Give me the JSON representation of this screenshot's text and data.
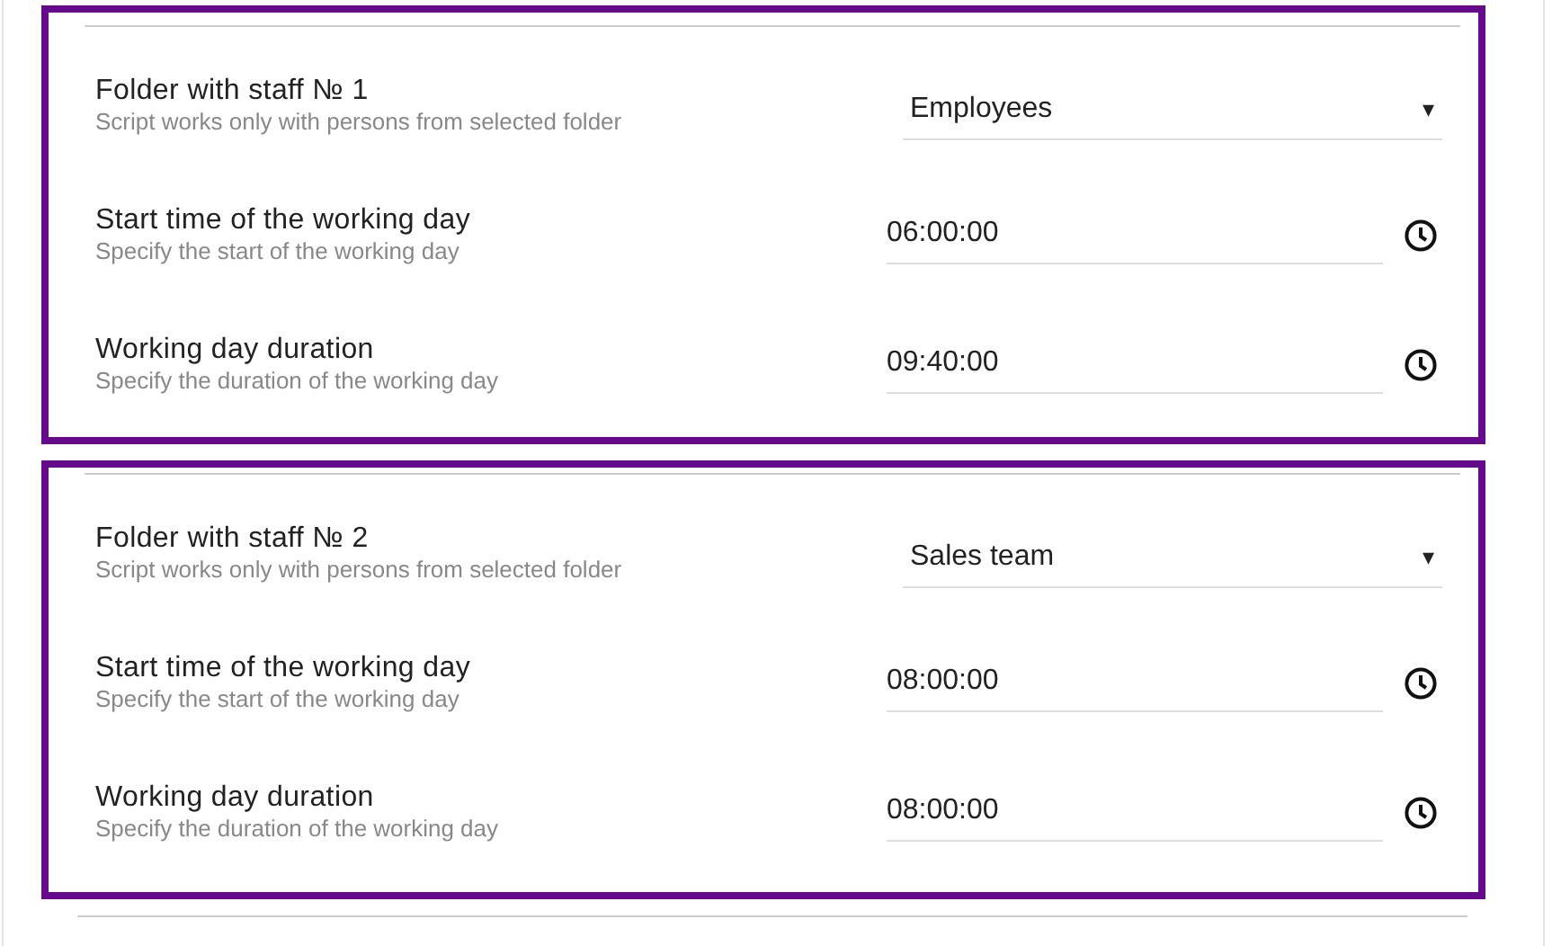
{
  "groups": [
    {
      "settings": [
        {
          "kind": "select",
          "label": "Folder with staff № 1",
          "hint": "Script works only with persons from selected folder",
          "value": "Employees",
          "caret": "▾"
        },
        {
          "kind": "time",
          "label": "Start time of the working day",
          "hint": "Specify the start of the working day",
          "value": "06:00:00"
        },
        {
          "kind": "time",
          "label": "Working day duration",
          "hint": "Specify the duration of the working day",
          "value": "09:40:00"
        }
      ]
    },
    {
      "settings": [
        {
          "kind": "select",
          "label": "Folder with staff № 2",
          "hint": "Script works only with persons from selected folder",
          "value": "Sales team",
          "caret": "▾"
        },
        {
          "kind": "time",
          "label": "Start time of the working day",
          "hint": "Specify the start of the working day",
          "value": "08:00:00"
        },
        {
          "kind": "time",
          "label": "Working day duration",
          "hint": "Specify the duration of the working day",
          "value": "08:00:00"
        }
      ]
    }
  ]
}
